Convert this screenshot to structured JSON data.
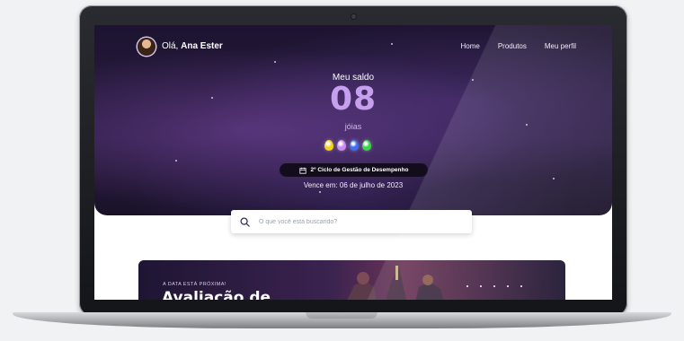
{
  "header": {
    "greeting_prefix": "Olá,",
    "user_name": "Ana Ester",
    "nav": [
      "Home",
      "Produtos",
      "Meu perfil"
    ]
  },
  "balance": {
    "label": "Meu saldo",
    "value": "08",
    "unit": "jóias",
    "gem_colors": [
      "#f5d21a",
      "#c98bf0",
      "#3f6ef2",
      "#3fd34a"
    ]
  },
  "cycle": {
    "label": "2º Ciclo de Gestão de Desempenho",
    "due": "Vence em: 06 de julho de 2023"
  },
  "search": {
    "placeholder": "O que você está buscando?"
  },
  "banner": {
    "kicker": "A DATA ESTÁ PRÓXIMA!",
    "headline": "Avaliação de"
  },
  "colors": {
    "accent": "#c6a0ee",
    "hero_bg": "#1d1430"
  }
}
